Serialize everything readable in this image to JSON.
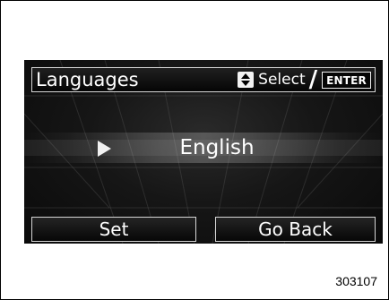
{
  "screen": {
    "header": {
      "title": "Languages",
      "select_label": "Select",
      "separator": "/",
      "enter_label": "ENTER"
    },
    "selection": {
      "language": "English"
    },
    "buttons": {
      "set": "Set",
      "go_back": "Go Back"
    },
    "icons": {
      "updown": "up-down-arrows-icon",
      "selector": "play-triangle-icon"
    }
  },
  "figure": {
    "code": "303107"
  },
  "colors": {
    "screen_background": "#0a0a0a",
    "text": "#ffffff",
    "border": "#d6d6d6",
    "page": "#ffffff"
  }
}
